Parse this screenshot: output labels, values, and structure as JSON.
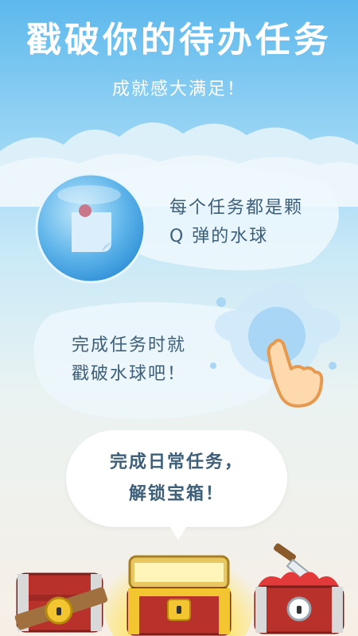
{
  "header": {
    "title": "戳破你的待办任务",
    "subtitle": "成就感大满足！"
  },
  "feature_bubble": {
    "line1": "每个任务都是颗",
    "line2": "Q 弹的水球"
  },
  "feature_pop": {
    "line1": "完成任务时就",
    "line2": "戳破水球吧！"
  },
  "speech": {
    "line1": "完成日常任务，",
    "line2": "解锁宝箱！"
  },
  "icons": [
    "note-icon",
    "pin-icon",
    "pointing-hand-icon",
    "splash-icon",
    "chest-locked-icon",
    "chest-open-icon",
    "chest-knife-icon"
  ],
  "colors": {
    "sky_top": "#5cb8ec",
    "text": "#3d5f7a",
    "chest_red": "#b8312b",
    "gold": "#f3c530"
  }
}
